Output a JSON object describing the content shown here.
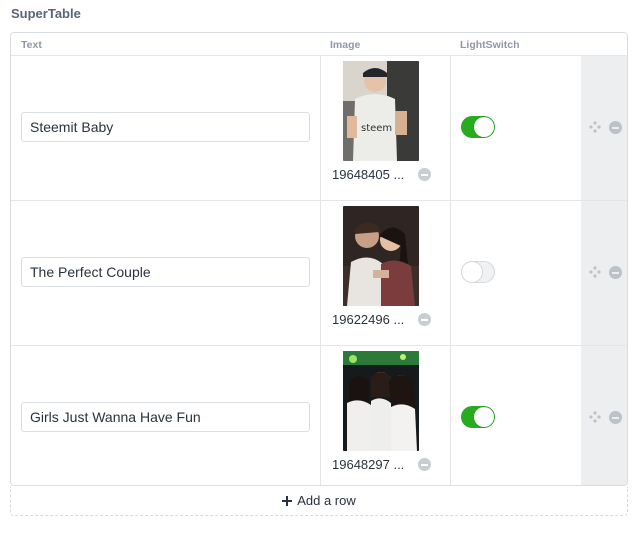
{
  "field": {
    "title": "SuperTable"
  },
  "columns": {
    "text": "Text",
    "image": "Image",
    "lightswitch": "LightSwitch"
  },
  "rows": [
    {
      "text": "Steemit Baby",
      "image_name": "19648405 ...",
      "lightswitch": true
    },
    {
      "text": "The Perfect Couple",
      "image_name": "19622496 ...",
      "lightswitch": false
    },
    {
      "text": "Girls Just Wanna Have Fun",
      "image_name": "19648297 ...",
      "lightswitch": true
    }
  ],
  "add_row": {
    "label": "Add a row"
  },
  "colors": {
    "toggle_on": "#27ab1f",
    "toggle_off": "#f0f1f3",
    "title": "#576575"
  },
  "icons": {
    "move": "move-icon",
    "remove": "remove-icon",
    "add": "plus-icon"
  }
}
